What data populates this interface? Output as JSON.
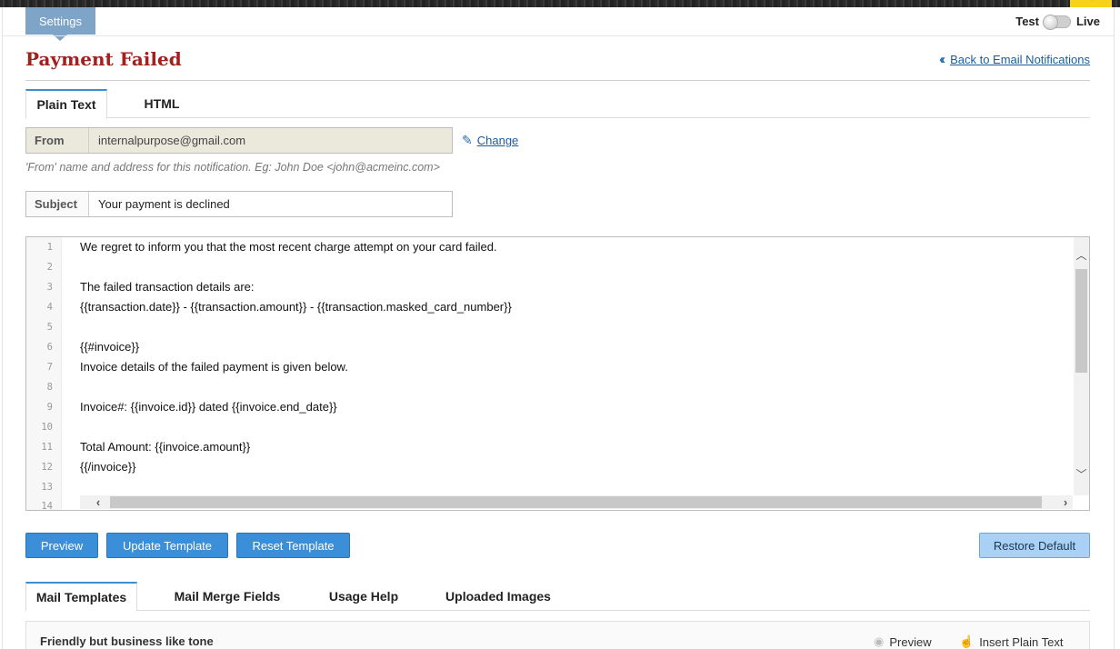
{
  "header": {
    "settings_tab": "Settings",
    "mode_left": "Test",
    "mode_right": "Live"
  },
  "page": {
    "title": "Payment Failed",
    "back_link": "Back to Email Notifications"
  },
  "format_tabs": [
    {
      "label": "Plain Text",
      "active": true
    },
    {
      "label": "HTML",
      "active": false
    }
  ],
  "from": {
    "label": "From",
    "value": "internalpurpose@gmail.com",
    "change_label": "Change",
    "hint": "'From' name and address for this notification. Eg: John Doe <john@acmeinc.com>"
  },
  "subject": {
    "label": "Subject",
    "value": "Your payment is declined"
  },
  "editor": {
    "line_numbers": [
      "1",
      "2",
      "3",
      "4",
      "5",
      "6",
      "7",
      "8",
      "9",
      "10",
      "11",
      "12",
      "13",
      "14"
    ],
    "lines": [
      "We regret to inform you that the most recent charge attempt on your card failed.",
      "",
      "The failed transaction details are:",
      "{{transaction.date}} - {{transaction.amount}} - {{transaction.masked_card_number}}",
      "",
      "{{#invoice}}",
      "Invoice details of the failed payment is given below.",
      "",
      "Invoice#: {{invoice.id}} dated {{invoice.end_date}}",
      "",
      "Total Amount: {{invoice.amount}}",
      "{{/invoice}}",
      "",
      ""
    ]
  },
  "actions": {
    "preview": "Preview",
    "update": "Update Template",
    "reset": "Reset Template",
    "restore": "Restore Default"
  },
  "bottom_tabs": [
    {
      "label": "Mail Templates",
      "active": true
    },
    {
      "label": "Mail Merge Fields",
      "active": false
    },
    {
      "label": "Usage Help",
      "active": false
    },
    {
      "label": "Uploaded Images",
      "active": false
    }
  ],
  "template_panel": {
    "name": "Friendly but business like tone",
    "preview_label": "Preview",
    "insert_label": "Insert Plain Text"
  },
  "colors": {
    "title": "#a2211c",
    "accent": "#3b8fd8",
    "settings_tab": "#7ea4c7"
  }
}
